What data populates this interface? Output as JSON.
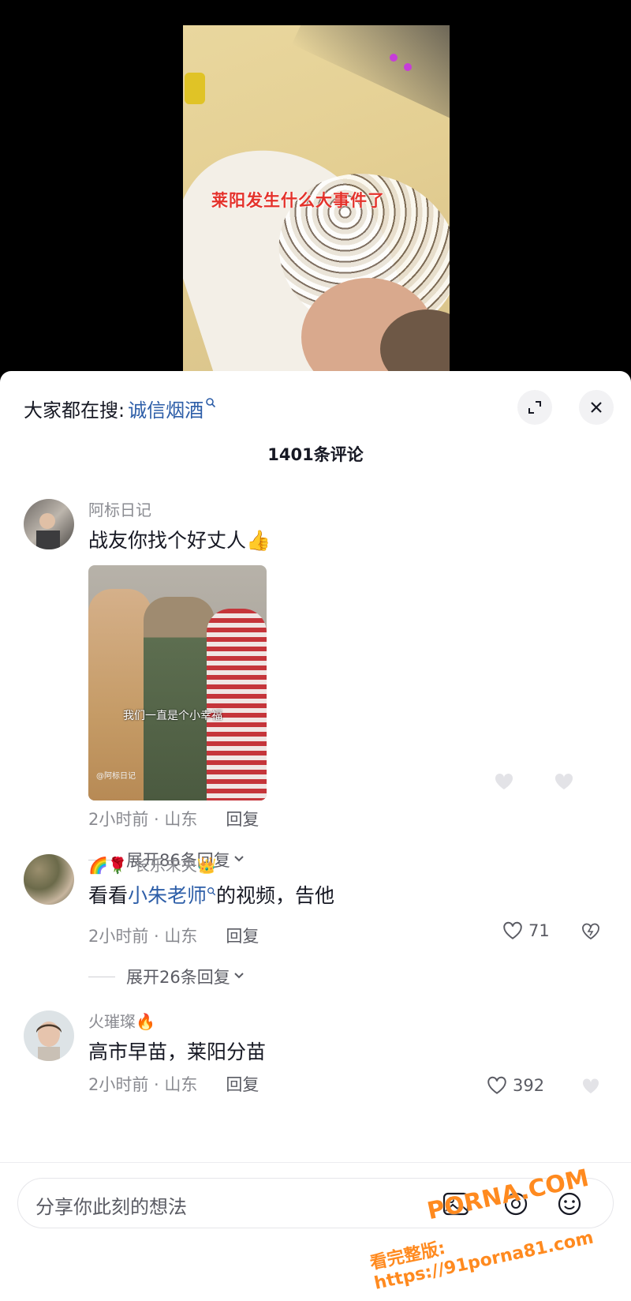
{
  "video": {
    "caption": "莱阳发生什么大事件了"
  },
  "sheet": {
    "search_label": "大家都在搜:",
    "search_keyword": "诚信烟酒",
    "comment_count": "1401条评论"
  },
  "comments": [
    {
      "username": "阿标日记",
      "text": "战友你找个好丈人",
      "emoji": "👍",
      "image_caption": "我们一直是个小幸福",
      "image_watermark": "@阿标日记",
      "time_location": "2小时前 · 山东",
      "reply_label": "回复",
      "expand_label": "展开86条回复"
    },
    {
      "username_prefix": "🌈🌹",
      "username": "长乐未央",
      "username_suffix": "👑",
      "text_before": "看看",
      "text_link": "小朱老师",
      "text_after": "的视频，告他",
      "time_location": "2小时前 · 山东",
      "reply_label": "回复",
      "likes": "71",
      "expand_label": "展开26条回复"
    },
    {
      "username": "火璀璨",
      "username_suffix": "🔥",
      "text": "高市早苗，莱阳分苗",
      "time_location": "2小时前 · 山东",
      "reply_label": "回复",
      "likes": "392"
    }
  ],
  "input": {
    "placeholder": "分享你此刻的想法"
  },
  "watermark": {
    "brand": "PORNA.COM",
    "url": "看完整版: https://91porna81.com"
  },
  "colors": {
    "link": "#2d5ea8",
    "caption": "#e4322b",
    "watermark": "#ff8a1f"
  }
}
